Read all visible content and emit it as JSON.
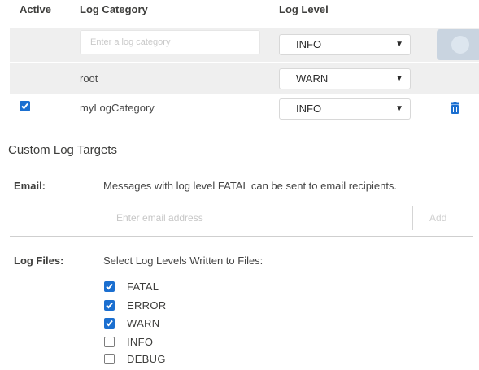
{
  "table": {
    "headers": {
      "active": "Active",
      "category": "Log Category",
      "level": "Log Level"
    },
    "new_row": {
      "category_placeholder": "Enter a log category",
      "level": "INFO"
    },
    "rows": [
      {
        "category": "root",
        "level": "WARN",
        "active": null
      },
      {
        "category": "myLogCategory",
        "level": "INFO",
        "active": true
      }
    ]
  },
  "targets": {
    "title": "Custom Log Targets",
    "email": {
      "label": "Email:",
      "description": "Messages with log level FATAL can be sent to email recipients.",
      "placeholder": "Enter email address",
      "add_label": "Add"
    },
    "files": {
      "label": "Log Files:",
      "description": "Select Log Levels Written to Files:",
      "levels": [
        {
          "name": "FATAL",
          "checked": true
        },
        {
          "name": "ERROR",
          "checked": true
        },
        {
          "name": "WARN",
          "checked": true
        },
        {
          "name": "INFO",
          "checked": false
        },
        {
          "name": "DEBUG",
          "checked": false
        }
      ]
    }
  },
  "colors": {
    "accent": "#1b6fd0",
    "row_bg": "#efefef"
  },
  "icons": {
    "dropdown": "chevron-down-icon",
    "delete": "trash-icon",
    "check": "check-icon"
  }
}
